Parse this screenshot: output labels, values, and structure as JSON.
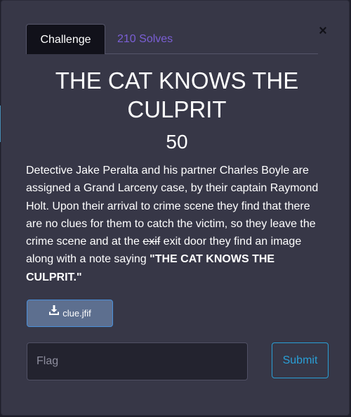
{
  "tabs": {
    "challenge": "Challenge",
    "solves": "210 Solves"
  },
  "close_icon": "×",
  "challenge": {
    "title": "THE CAT KNOWS THE CULPRIT",
    "points": "50",
    "description": {
      "part1": "Detective Jake Peralta and his partner Charles Boyle are assigned a Grand Larceny case, by their captain Raymond Holt. Upon their arrival to crime scene they find that there are no clues for them to catch the victim, so they leave the crime scene and at the ",
      "strike": "exif",
      "part2": " exit door they find an image along with a note saying ",
      "bold": "\"THE CAT KNOWS THE CULPRIT.\""
    },
    "file": {
      "name": "clue.jfif",
      "icon": "download-icon"
    }
  },
  "form": {
    "flag_placeholder": "Flag",
    "submit_label": "Submit"
  },
  "colors": {
    "accent_purple": "#7b5fd6",
    "submit_blue": "#2a9fd6",
    "modal_bg": "#373747"
  }
}
